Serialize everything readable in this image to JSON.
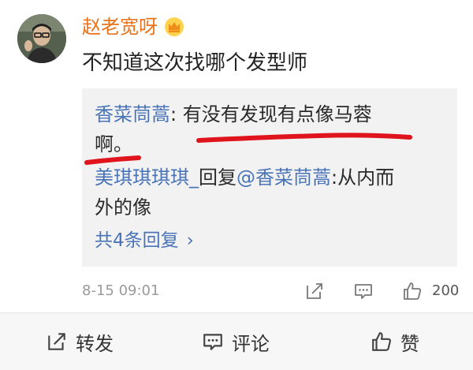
{
  "comment": {
    "username": "赵老宽呀",
    "text": "不知道这次找哪个发型师"
  },
  "replies": {
    "reply1": {
      "name": "香菜茼蒿",
      "sep": ": ",
      "text_line1": "有没有发现有点像马蓉",
      "text_line2": "啊。"
    },
    "reply2": {
      "name": "美琪琪琪琪_",
      "reply_word": "回复",
      "mention": "@香菜茼蒿",
      "sep": ":",
      "text_line1": "从内而",
      "text_line2": "外的像"
    },
    "more_label": "共4条回复",
    "more_arrow": "›"
  },
  "meta": {
    "timestamp": "8-15 09:01",
    "like_count": "200"
  },
  "bottom_bar": {
    "repost_label": "转发",
    "comment_label": "评论",
    "like_label": "赞"
  },
  "colors": {
    "username": "#e8731b",
    "link": "#4a74b8",
    "underline": "#e0141c"
  }
}
